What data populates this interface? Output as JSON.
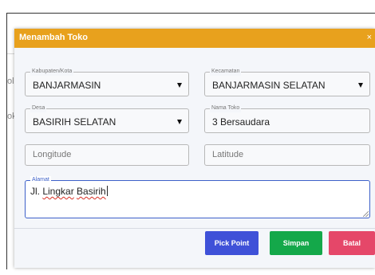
{
  "background": {
    "fragment_a": "ol",
    "fragment_b": "ok"
  },
  "modal": {
    "title": "Menambah Toko",
    "close": "×"
  },
  "form": {
    "kabupaten": {
      "label": "Kabupaten/Kota",
      "value": "BANJARMASIN"
    },
    "kecamatan": {
      "label": "Kecamatan",
      "value": "BANJARMASIN SELATAN"
    },
    "desa": {
      "label": "Desa",
      "value": "BASIRIH SELATAN"
    },
    "nama_toko": {
      "label": "Nama Toko",
      "value": "3 Bersaudara"
    },
    "longitude": {
      "placeholder": "Longitude"
    },
    "latitude": {
      "placeholder": "Latitude"
    },
    "alamat": {
      "label": "Alamat",
      "prefix": "Jl. ",
      "word1": "Lingkar",
      "space": " ",
      "word2": "Basirih"
    }
  },
  "buttons": {
    "pick_point": "Pick Point",
    "simpan": "Simpan",
    "batal": "Batal"
  },
  "colors": {
    "header": "#e8a11d",
    "pick_point": "#3f51d8",
    "simpan": "#14a84a",
    "batal": "#e54769",
    "focus_border": "#3d61c9"
  },
  "icons": {
    "close": "close-icon",
    "dropdown": "caret-down-icon",
    "resize": "resize-handle-icon"
  }
}
